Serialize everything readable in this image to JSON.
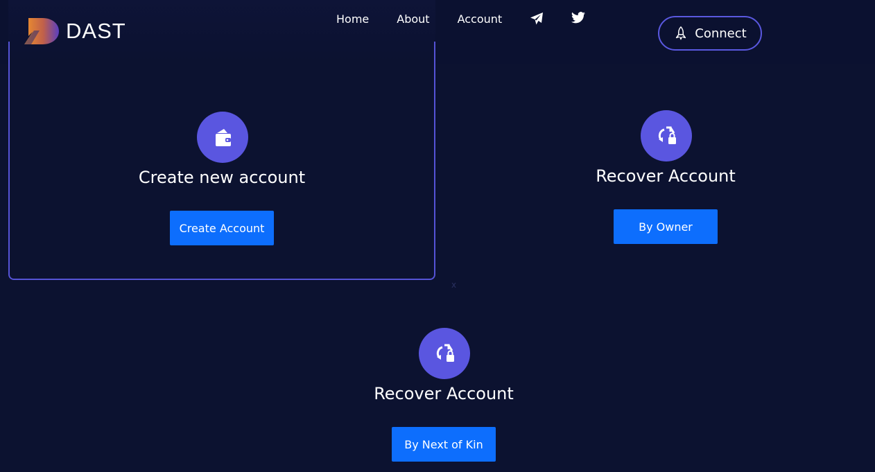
{
  "brand": {
    "name": "DAST",
    "logo_icon": "dast-logo-icon"
  },
  "nav": {
    "items": [
      "Home",
      "About",
      "Account"
    ],
    "telegram_icon": "telegram-icon",
    "twitter_icon": "twitter-icon"
  },
  "connect": {
    "label": "Connect",
    "icon": "rocket-icon"
  },
  "cards": {
    "create": {
      "title": "Create new account",
      "button": "Create Account",
      "icon": "wallet-icon"
    },
    "recover_owner": {
      "title": "Recover Account",
      "button": "By Owner",
      "icon": "recover-lock-icon"
    },
    "recover_kin": {
      "title": "Recover Account",
      "button": "By Next of Kin",
      "icon": "recover-lock-icon"
    }
  },
  "misc": {
    "stray_text": "x"
  },
  "colors": {
    "background": "#0c1230",
    "accent": "#5a56e0",
    "button": "#0d6efd",
    "logo_orange": "#f0922b",
    "logo_purple": "#5a3fc0"
  }
}
